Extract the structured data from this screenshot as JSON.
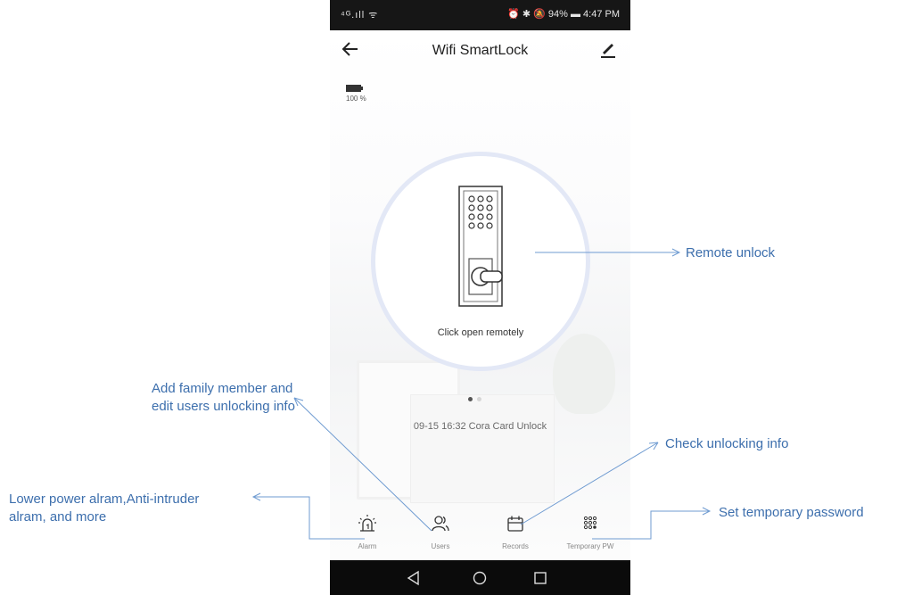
{
  "status_bar": {
    "signal": "⁴ᴳ.ıll ᯤ",
    "right": "⏰ ✱ 🔕 94% ▬ 4:47 PM"
  },
  "header": {
    "title": "Wifi SmartLock",
    "back_icon": "back-arrow-icon",
    "edit_icon": "pencil-icon"
  },
  "battery": {
    "level": "100 %",
    "icon": "battery-icon"
  },
  "lock_panel": {
    "action_text": "Click open remotely",
    "icon": "door-lock-keypad-icon",
    "ring_color": "#e3e8f6"
  },
  "pager": {
    "pages": 2,
    "active": 1
  },
  "latest_record": "09-15 16:32  Cora Card Unlock",
  "tabs": [
    {
      "label": "Alarm",
      "icon": "alarm-icon"
    },
    {
      "label": "Users",
      "icon": "users-icon"
    },
    {
      "label": "Records",
      "icon": "calendar-icon"
    },
    {
      "label": "Temporary PW",
      "icon": "keypad-icon"
    }
  ],
  "system_nav": [
    "back-triangle-icon",
    "home-circle-icon",
    "recents-square-icon"
  ],
  "annotations": {
    "remote_unlock": "Remote unlock",
    "users_line1": "Add family member and",
    "users_line2": "edit users unlocking info",
    "records": "Check unlocking info",
    "alarm_line1": "Lower power alram,Anti-intruder",
    "alarm_line2": "alram, and more",
    "temp_pw": "Set temporary password"
  },
  "colors": {
    "annotation": "#3d6fad",
    "annotation_line": "#6f9bd1"
  }
}
